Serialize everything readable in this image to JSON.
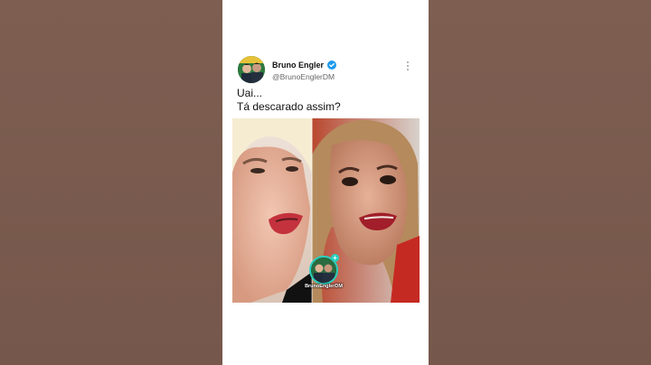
{
  "tweet": {
    "author_name": "Bruno Engler",
    "author_handle": "@BrunoEnglerDM",
    "text_line1": "Uai...",
    "text_line2": "Tá descarado assim?"
  },
  "media": {
    "watermark_label": "BrunoEnglerDM"
  },
  "icons": {
    "verified": "verified-badge-icon",
    "more": "more-options-icon",
    "watermark_plus": "plus-icon"
  },
  "colors": {
    "verified_blue": "#1d9bf0",
    "watermark_ring": "#2ad0c0",
    "side_background": "#7a5b4f"
  }
}
